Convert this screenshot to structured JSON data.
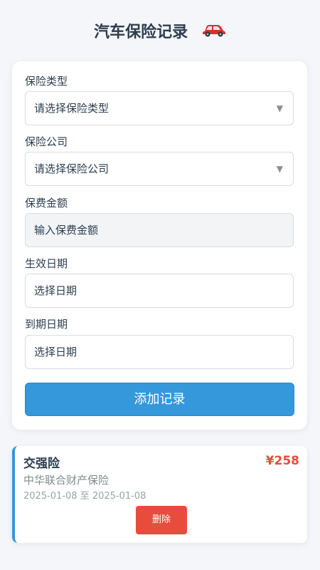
{
  "header": {
    "title": "汽车保险记录",
    "icon": "car-icon"
  },
  "form": {
    "type_label": "保险类型",
    "type_value": "请选择保险类型",
    "company_label": "保险公司",
    "company_value": "请选择保险公司",
    "premium_label": "保费金额",
    "premium_placeholder": "输入保费金额",
    "start_label": "生效日期",
    "start_value": "选择日期",
    "end_label": "到期日期",
    "end_value": "选择日期",
    "dropdown_arrow": "▼",
    "submit_label": "添加记录"
  },
  "records": [
    {
      "type": "交强险",
      "amount": "¥258",
      "company": "中华联合财产保险",
      "dates": "2025-01-08 至 2025-01-08",
      "delete_label": "删除"
    }
  ],
  "colors": {
    "accent": "#3498db",
    "danger": "#e74c3c",
    "text": "#2c3e50"
  }
}
